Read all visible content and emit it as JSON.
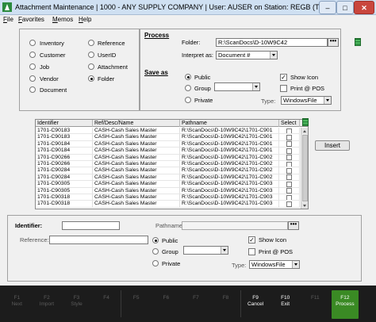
{
  "window": {
    "title": "Attachment Maintenance  |  1000 - ANY SUPPLY COMPANY  |  User: AUSER on Station: REGB (TID:91)",
    "min_glyph": "–",
    "max_glyph": "□",
    "close_glyph": "✕"
  },
  "menu": [
    "File",
    "Favorites",
    "Memos",
    "Help"
  ],
  "attach_types": {
    "left": [
      "Inventory",
      "Customer",
      "Job",
      "Vendor",
      "Document"
    ],
    "right": [
      "Reference",
      "UserID",
      "Attachment",
      "Folder"
    ],
    "selected": "Folder"
  },
  "process": {
    "heading": "Process",
    "folder_label": "Folder:",
    "folder_value": "R:\\ScanDocs\\D-10W9C42",
    "interpret_label": "Interpret as:",
    "interpret_value": "Document #"
  },
  "saveas": {
    "heading": "Save as",
    "options": [
      "Public",
      "Group",
      "Private"
    ],
    "selected": "Public",
    "group_value": "",
    "show_icon_label": "Show Icon",
    "show_icon_checked": true,
    "print_pos_label": "Print @ POS",
    "print_pos_checked": false,
    "type_label": "Type:",
    "type_value": "WindowsFile"
  },
  "grid": {
    "columns": [
      "Identifier",
      "Ref/Desc/Name",
      "Pathname",
      "Select"
    ],
    "rows": [
      {
        "id": "1701-C90183",
        "ref": "CASH-Cash Sales Master",
        "path": "R:\\ScanDocs\\D-10W9C42\\1701-C901"
      },
      {
        "id": "1701-C90183",
        "ref": "CASH-Cash Sales Master",
        "path": "R:\\ScanDocs\\D-10W9C42\\1701-C901"
      },
      {
        "id": "1701-C90184",
        "ref": "CASH-Cash Sales Master",
        "path": "R:\\ScanDocs\\D-10W9C42\\1701-C901"
      },
      {
        "id": "1701-C90184",
        "ref": "CASH-Cash Sales Master",
        "path": "R:\\ScanDocs\\D-10W9C42\\1701-C901"
      },
      {
        "id": "1701-C90266",
        "ref": "CASH-Cash Sales Master",
        "path": "R:\\ScanDocs\\D-10W9C42\\1701-C902"
      },
      {
        "id": "1701-C90266",
        "ref": "CASH-Cash Sales Master",
        "path": "R:\\ScanDocs\\D-10W9C42\\1701-C902"
      },
      {
        "id": "1701-C90284",
        "ref": "CASH-Cash Sales Master",
        "path": "R:\\ScanDocs\\D-10W9C42\\1701-C902"
      },
      {
        "id": "1701-C90284",
        "ref": "CASH-Cash Sales Master",
        "path": "R:\\ScanDocs\\D-10W9C42\\1701-C902"
      },
      {
        "id": "1701-C90305",
        "ref": "CASH-Cash Sales Master",
        "path": "R:\\ScanDocs\\D-10W9C42\\1701-C903"
      },
      {
        "id": "1701-C90305",
        "ref": "CASH-Cash Sales Master",
        "path": "R:\\ScanDocs\\D-10W9C42\\1701-C903"
      },
      {
        "id": "1701-C90318",
        "ref": "CASH-Cash Sales Master",
        "path": "R:\\ScanDocs\\D-10W9C42\\1701-C903"
      },
      {
        "id": "1701-C90318",
        "ref": "CASH-Cash Sales Master",
        "path": "R:\\ScanDocs\\D-10W9C42\\1701-C903"
      }
    ]
  },
  "insert_label": "Insert",
  "detail": {
    "identifier_label": "Identifier:",
    "identifier_value": "",
    "pathname_label": "Pathname:",
    "pathname_value": "",
    "reference_label": "Reference:",
    "reference_value": "",
    "options": [
      "Public",
      "Group",
      "Private"
    ],
    "selected": "Public",
    "group_value": "",
    "show_icon_label": "Show Icon",
    "show_icon_checked": true,
    "print_pos_label": "Print @ POS",
    "print_pos_checked": false,
    "type_label": "Type:",
    "type_value": "WindowsFile"
  },
  "ellipsis": "•••",
  "fkeys": [
    {
      "key": "F1",
      "label": "Next",
      "state": "disabled"
    },
    {
      "key": "F2",
      "label": "Import",
      "state": "disabled"
    },
    {
      "key": "F3",
      "label": "Style",
      "state": "disabled"
    },
    {
      "key": "F4",
      "label": "",
      "state": "disabled"
    },
    {
      "key": "F5",
      "label": "",
      "state": "disabled"
    },
    {
      "key": "F6",
      "label": "",
      "state": "disabled"
    },
    {
      "key": "F7",
      "label": "",
      "state": "disabled"
    },
    {
      "key": "F8",
      "label": "",
      "state": "disabled"
    },
    {
      "key": "F9",
      "label": "Cancel",
      "state": "active"
    },
    {
      "key": "F10",
      "label": "Exit",
      "state": "active"
    },
    {
      "key": "F11",
      "label": "",
      "state": "disabled"
    },
    {
      "key": "F12",
      "label": "Process",
      "state": "primary"
    }
  ],
  "colors": {
    "primary_key": "#3a8a24",
    "keybar": "#1c1c1c",
    "title_bg": "#cfe0f2"
  }
}
